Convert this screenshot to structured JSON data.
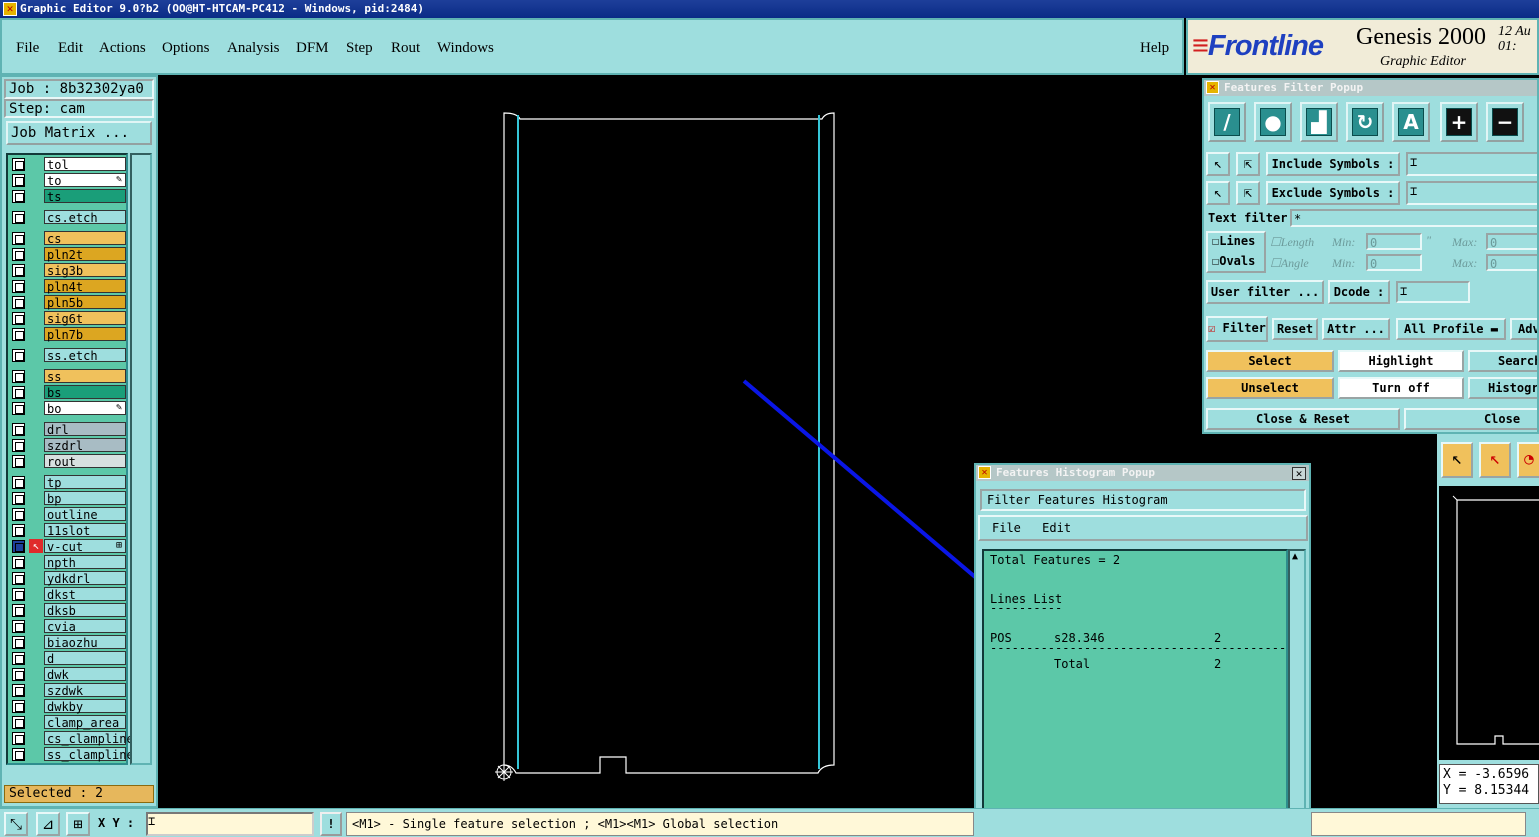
{
  "window": {
    "title": "Graphic Editor 9.0?b2 (OO@HT-HTCAM-PC412 - Windows, pid:2484)"
  },
  "menu": {
    "items": [
      "File",
      "Edit",
      "Actions",
      "Options",
      "Analysis",
      "DFM",
      "Step",
      "Rout",
      "Windows"
    ],
    "help": "Help"
  },
  "brand": {
    "logo_prefix": "≡",
    "logo": "Frontline",
    "product": "Genesis 2000",
    "subtitle": "Graphic Editor",
    "date": "12 Au",
    "time": "01:"
  },
  "job": {
    "job_label": "Job : 8b32302ya0",
    "step_label": "Step: cam",
    "matrix_button": "Job Matrix ..."
  },
  "layers": [
    {
      "name": "tol",
      "color": "#ffffff"
    },
    {
      "name": "to",
      "color": "#ffffff",
      "mark": "✎"
    },
    {
      "name": "ts",
      "color": "#1a9e79"
    },
    {
      "name": "cs.etch",
      "color": "#9edede"
    },
    {
      "name": "cs",
      "color": "#f0c15c"
    },
    {
      "name": "pln2t",
      "color": "#dca621"
    },
    {
      "name": "sig3b",
      "color": "#f0c15c"
    },
    {
      "name": "pln4t",
      "color": "#dca621"
    },
    {
      "name": "pln5b",
      "color": "#dca621"
    },
    {
      "name": "sig6t",
      "color": "#f0c15c"
    },
    {
      "name": "pln7b",
      "color": "#dca621"
    },
    {
      "name": "ss.etch",
      "color": "#9edede"
    },
    {
      "name": "ss",
      "color": "#f0c15c"
    },
    {
      "name": "bs",
      "color": "#1a9e79"
    },
    {
      "name": "bo",
      "color": "#ffffff",
      "mark": "✎"
    },
    {
      "name": "drl",
      "color": "#a8bcc4"
    },
    {
      "name": "szdrl",
      "color": "#a8bcc4"
    },
    {
      "name": "rout",
      "color": "#d8e0e0"
    },
    {
      "name": "tp",
      "color": "#9edede"
    },
    {
      "name": "bp",
      "color": "#9edede"
    },
    {
      "name": "outline",
      "color": "#9edede"
    },
    {
      "name": "11slot",
      "color": "#9edede"
    },
    {
      "name": "v-cut",
      "color": "#9edede",
      "active": true,
      "mark": "⊞"
    },
    {
      "name": "npth",
      "color": "#9edede"
    },
    {
      "name": "ydkdrl",
      "color": "#9edede"
    },
    {
      "name": "dkst",
      "color": "#9edede"
    },
    {
      "name": "dksb",
      "color": "#9edede"
    },
    {
      "name": "cvia",
      "color": "#9edede"
    },
    {
      "name": "biaozhu",
      "color": "#9edede"
    },
    {
      "name": "d",
      "color": "#9edede"
    },
    {
      "name": "dwk",
      "color": "#9edede"
    },
    {
      "name": "szdwk",
      "color": "#9edede"
    },
    {
      "name": "dwkby",
      "color": "#9edede"
    },
    {
      "name": "clamp_area",
      "color": "#9edede"
    },
    {
      "name": "cs_clampline",
      "color": "#9edede"
    },
    {
      "name": "ss_clampline",
      "color": "#9edede"
    }
  ],
  "selected_label": "Selected : 2",
  "filter_popup": {
    "title": "Features Filter Popup",
    "include_label": "Include Symbols :",
    "exclude_label": "Exclude Symbols :",
    "text_filter_label": "Text filter",
    "text_filter_value": "*",
    "lines_label": "Lines",
    "ovals_label": "Ovals",
    "length_label": "Length",
    "angle_label": "Angle",
    "min_label": "Min:",
    "max_label": "Max:",
    "length_min": "0",
    "length_max": "0",
    "angle_min": "0",
    "angle_max": "0",
    "deg_mark": "\"",
    "user_filter": "User filter ...",
    "dcode_label": "Dcode :",
    "filter_toggle": "Filter",
    "reset": "Reset",
    "attr": "Attr ...",
    "all_profile": "All Profile",
    "adv": "Adva",
    "select": "Select",
    "highlight": "Highlight",
    "search": "Search",
    "unselect": "Unselect",
    "turn_off": "Turn off",
    "histogram": "Histogra",
    "close_reset": "Close & Reset",
    "close": "Close"
  },
  "histogram_popup": {
    "title": "Features Histogram Popup",
    "header": "Filter Features Histogram",
    "menu": [
      "File",
      "Edit"
    ],
    "total_features": "Total Features = 2",
    "list_title": "Lines List",
    "list_rule": "----------",
    "row": {
      "pol": "POS",
      "symbol": "s28.346",
      "count": "2"
    },
    "separator": "-----------------------------------------",
    "total_label": "Total",
    "total_count": "2"
  },
  "coords": {
    "x": "X = -3.6596",
    "y": "Y = 8.15344"
  },
  "status": {
    "xy_label": "X Y :",
    "bang": "!",
    "message": "<M1> - Single feature selection ; <M1><M1> Global selection"
  },
  "colors": {
    "panel": "#9edede",
    "list_bg": "#5cc8a8",
    "accent": "#f0c15c",
    "title_bar": "#0a2b86",
    "annotation_arrow": "#0a16e6"
  }
}
